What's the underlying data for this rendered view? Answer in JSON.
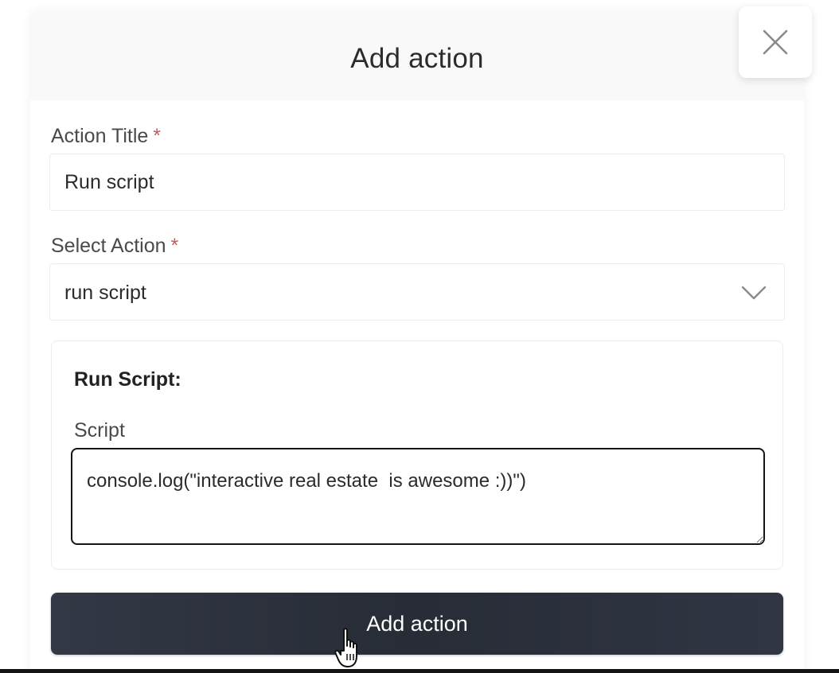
{
  "modal": {
    "title": "Add action"
  },
  "form": {
    "title_field": {
      "label": "Action Title",
      "required_mark": "*",
      "value": "Run script"
    },
    "action_select": {
      "label": "Select Action",
      "required_mark": "*",
      "selected": "run script"
    },
    "script_panel": {
      "heading": "Run Script:",
      "script_label": "Script",
      "script_value": "console.log(\"interactive real estate  is awesome :))\")"
    },
    "submit_label": "Add action"
  },
  "icons": {
    "close": "close-icon",
    "dropdown": "chevron-down-icon",
    "resize": "resize-grip-icon",
    "pointer": "hand-pointer-cursor"
  },
  "colors": {
    "button_bg": "#2b303b",
    "required": "#c85a5a",
    "header_bg": "#f9f9f9",
    "text": "#2b2b2b"
  }
}
